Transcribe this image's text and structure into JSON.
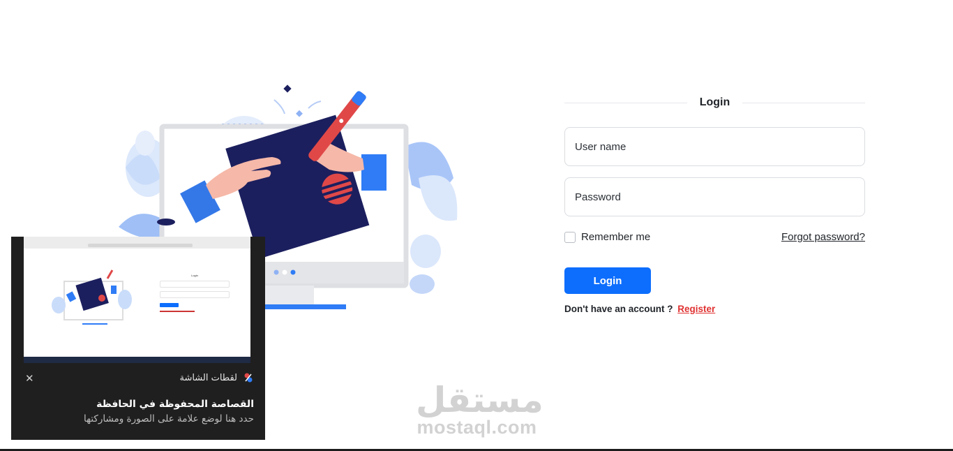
{
  "login": {
    "title": "Login",
    "username_placeholder": "User name",
    "password_placeholder": "Password",
    "remember_label": "Remember me",
    "forgot_label": "Forgot password?",
    "login_button": "Login",
    "no_account_text": "Don't have an account ?",
    "register_link": "Register"
  },
  "watermark": {
    "arabic": "مستقل",
    "latin": "mostaql.com"
  },
  "snip_notification": {
    "app_name": "لقطات الشاشة",
    "title": "القصاصة المحفوظة في الحافظة",
    "subtitle": "حدد هنا لوضع علامة على الصورة ومشاركتها",
    "close_icon": "close-icon",
    "app_icon": "snipping-tool-icon"
  },
  "colors": {
    "primary": "#0d6efd",
    "register": "#e03131",
    "illustration_navy": "#1c1f5e",
    "illustration_blue": "#2f7cf6",
    "illustration_red": "#e04848"
  }
}
